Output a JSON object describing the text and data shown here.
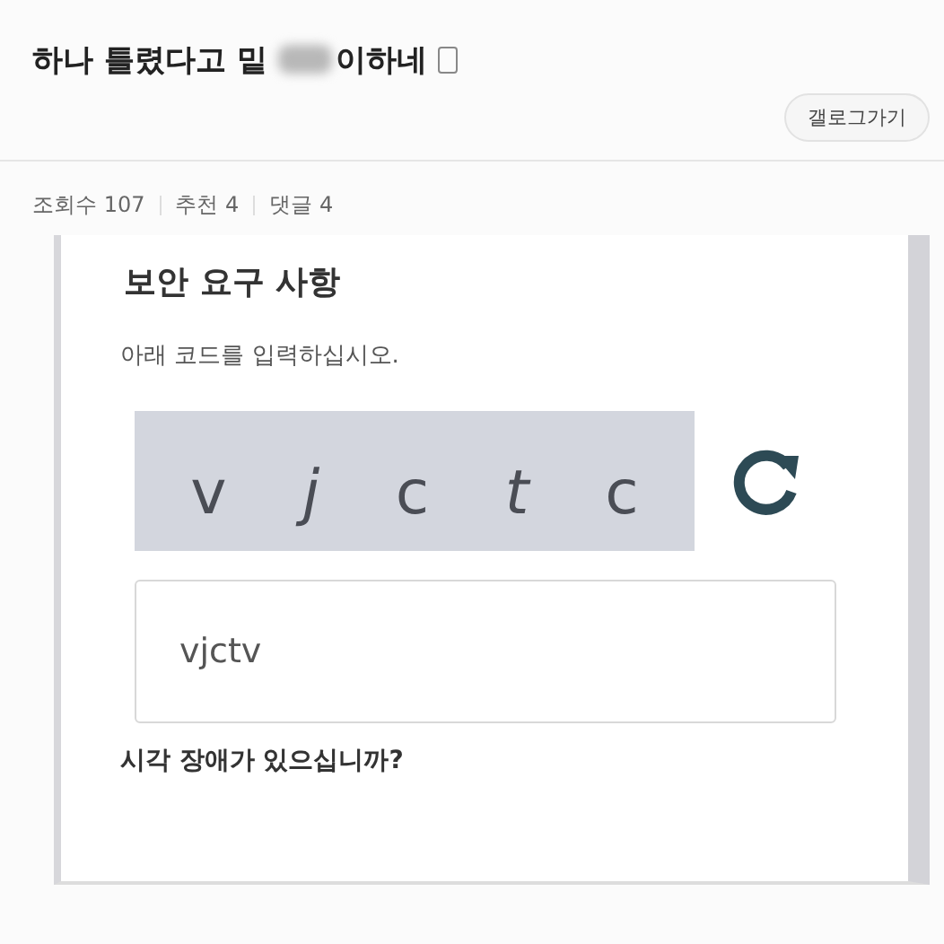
{
  "post": {
    "title_start": "하나 틀렸다고 밑",
    "title_end": "이하네",
    "gallog_button": "갤로그가기"
  },
  "stats": [
    {
      "label": "조회수 107"
    },
    {
      "label": "추천 4"
    },
    {
      "label": "댓글 4"
    }
  ],
  "captcha": {
    "heading": "보안 요구 사항",
    "instruction": "아래 코드를 입력하십시오.",
    "letters": [
      "v",
      "j",
      "c",
      "t",
      "c"
    ],
    "value": "vjctv",
    "help_link": "시각 장애가 있으십니까?"
  }
}
